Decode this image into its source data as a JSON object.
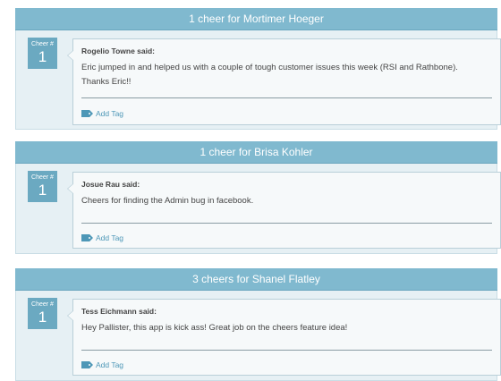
{
  "cheers": [
    {
      "title": "1 cheer for Mortimer Hoeger",
      "badge_label": "Cheer #",
      "badge_number": "1",
      "author": "Rogelio Towne said:",
      "message": "Eric jumped in and helped us with a couple of tough customer issues this week (RSI and Rathbone). Thanks Eric!!",
      "add_tag_label": "Add Tag"
    },
    {
      "title": "1 cheer for Brisa Kohler",
      "badge_label": "Cheer #",
      "badge_number": "1",
      "author": "Josue Rau said:",
      "message": "Cheers for finding the Admin bug in facebook.",
      "add_tag_label": "Add Tag"
    },
    {
      "title": "3 cheers for Shanel Flatley",
      "badge_label": "Cheer #",
      "badge_number": "1",
      "author": "Tess Eichmann said:",
      "message": "Hey Pallister, this app is kick ass! Great job on the cheers feature idea!",
      "add_tag_label": "Add Tag"
    }
  ],
  "colors": {
    "header_bg": "#80b9cf",
    "body_bg": "#e6f0f4",
    "badge_bg": "#6ba9c1",
    "link": "#4d97b7"
  },
  "icons": {
    "add_tag": "tag-icon"
  }
}
